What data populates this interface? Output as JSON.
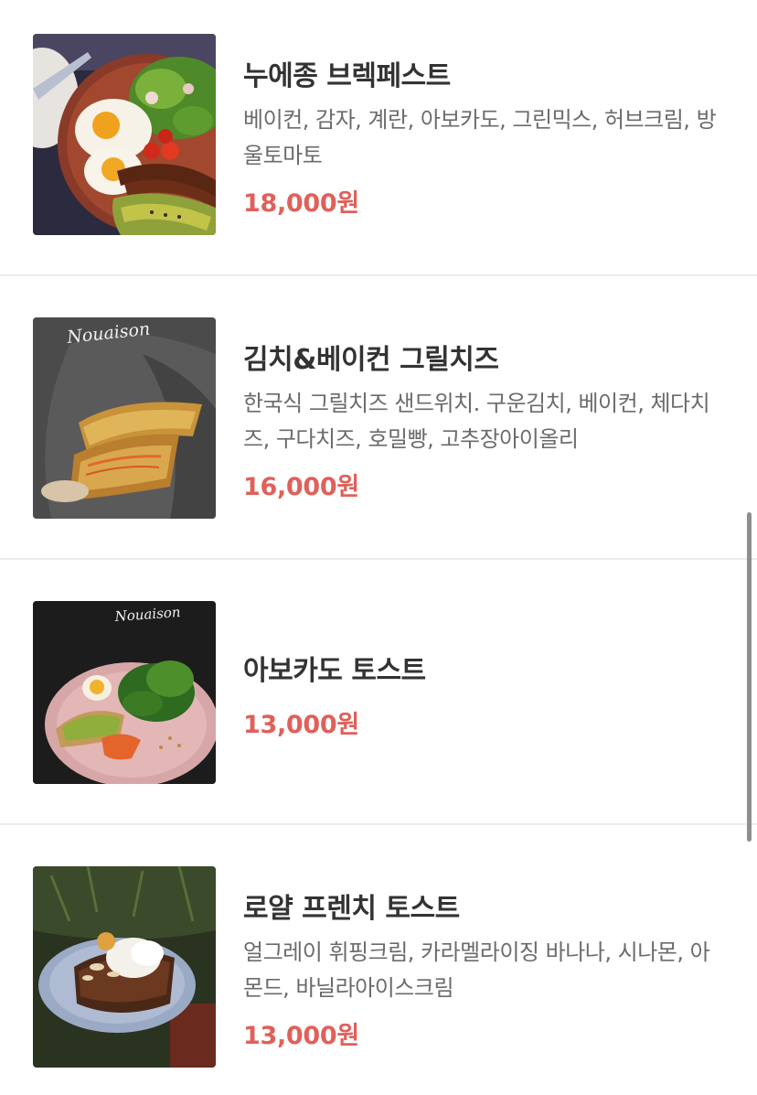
{
  "menu": {
    "items": [
      {
        "name": "누에종 브렉페스트",
        "description": "베이컨, 감자, 계란, 아보카도, 그린믹스, 허브크림, 방울토마토",
        "price": "18,000원",
        "image_icon": "breakfast-plate-photo"
      },
      {
        "name": "김치&베이컨 그릴치즈",
        "description": "한국식 그릴치즈 샌드위치. 구운김치, 베이컨, 체다치즈, 구다치즈, 호밀빵, 고추장아이올리",
        "price": "16,000원",
        "image_icon": "grilled-cheese-photo",
        "image_text": "Nouaison"
      },
      {
        "name": "아보카도 토스트",
        "description": "",
        "price": "13,000원",
        "image_icon": "avocado-toast-photo",
        "image_text": "Nouaison"
      },
      {
        "name": "로얄 프렌치 토스트",
        "description": "얼그레이 휘핑크림, 카라멜라이징 바나나, 시나몬, 아몬드, 바닐라아이스크림",
        "price": "13,000원",
        "image_icon": "french-toast-photo"
      }
    ]
  },
  "colors": {
    "price": "#e0605a",
    "name": "#333333",
    "description": "#6b6b6b",
    "divider": "#ececec",
    "scrollbar": "#8e8e8e"
  }
}
